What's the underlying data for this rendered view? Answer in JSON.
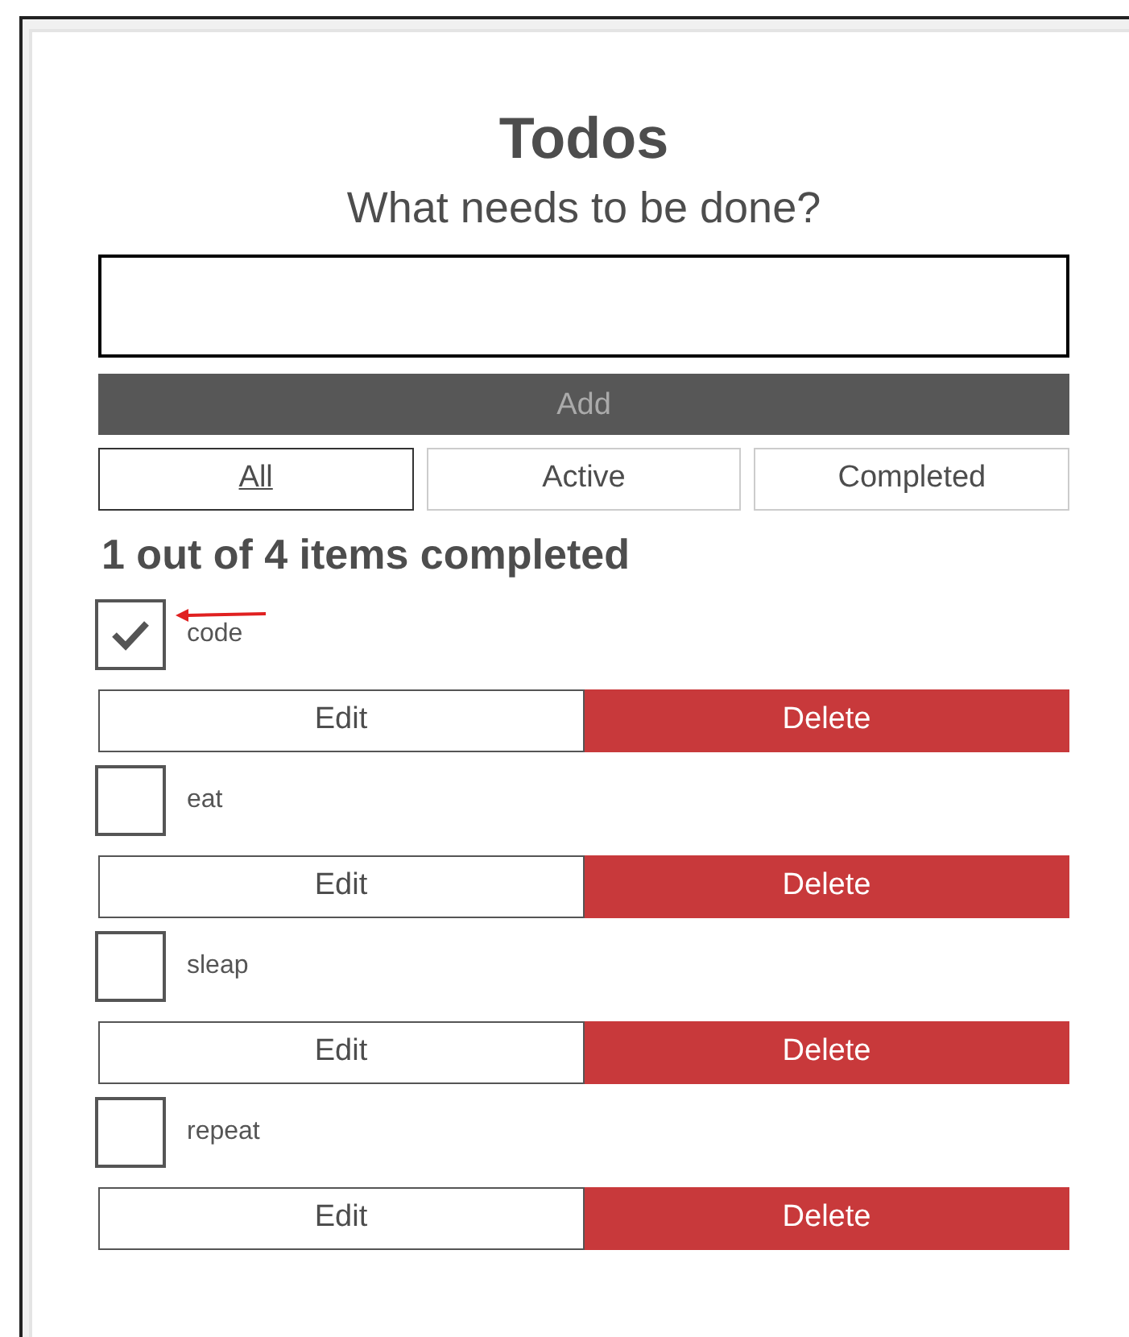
{
  "title": "Todos",
  "prompt": "What needs to be done?",
  "add_button": "Add",
  "filters": [
    {
      "label": "All",
      "selected": true
    },
    {
      "label": "Active",
      "selected": false
    },
    {
      "label": "Completed",
      "selected": false
    }
  ],
  "summary": "1 out of 4 items completed",
  "todos": [
    {
      "name": "code",
      "checked": true,
      "edit": "Edit",
      "delete": "Delete"
    },
    {
      "name": "eat",
      "checked": false,
      "edit": "Edit",
      "delete": "Delete"
    },
    {
      "name": "sleap",
      "checked": false,
      "edit": "Edit",
      "delete": "Delete"
    },
    {
      "name": "repeat",
      "checked": false,
      "edit": "Edit",
      "delete": "Delete"
    }
  ]
}
